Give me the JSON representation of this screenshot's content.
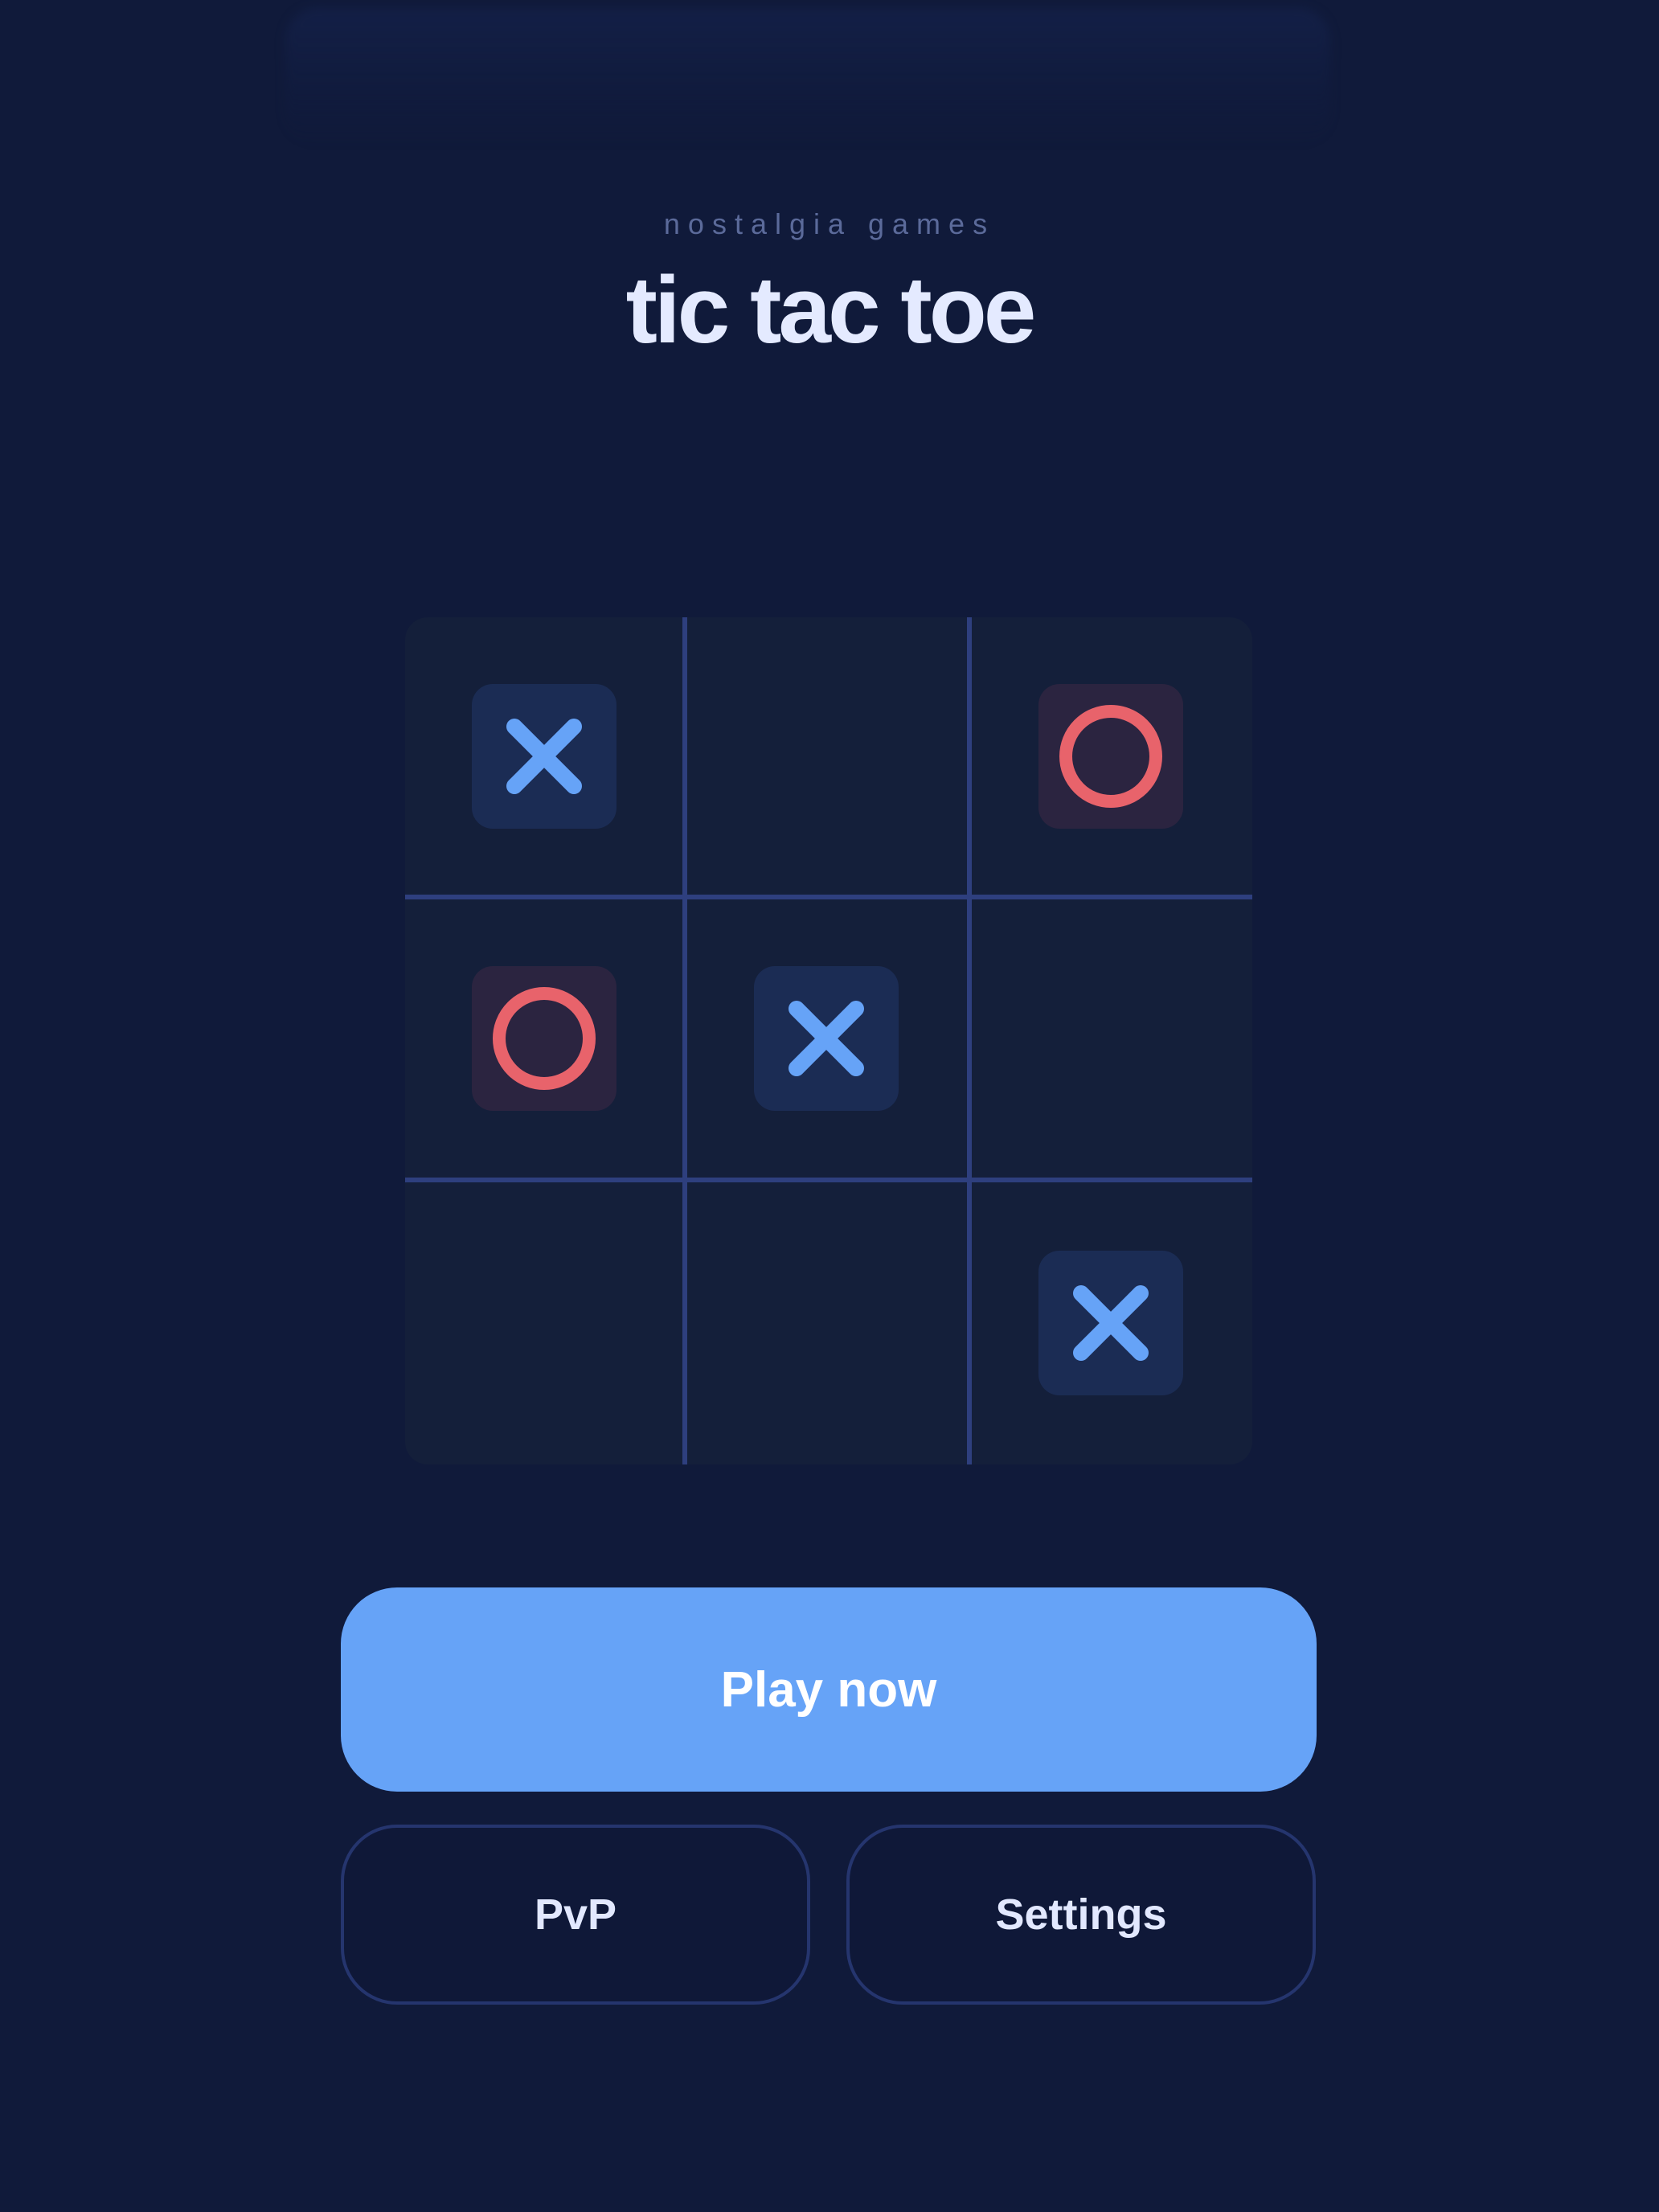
{
  "header": {
    "subtitle": "nostalgia games",
    "title": "tic tac toe"
  },
  "board": {
    "cells": [
      [
        "X",
        "",
        "O"
      ],
      [
        "O",
        "X",
        ""
      ],
      [
        "",
        "",
        "X"
      ]
    ]
  },
  "actions": {
    "play_label": "Play now",
    "pvp_label": "PvP",
    "settings_label": "Settings"
  },
  "colors": {
    "background": "#101a3a",
    "x_mark": "#66a3f7",
    "o_mark": "#e8636b",
    "accent": "#66a3f7"
  },
  "icons": {
    "x": "x-mark-icon",
    "o": "o-mark-icon"
  }
}
